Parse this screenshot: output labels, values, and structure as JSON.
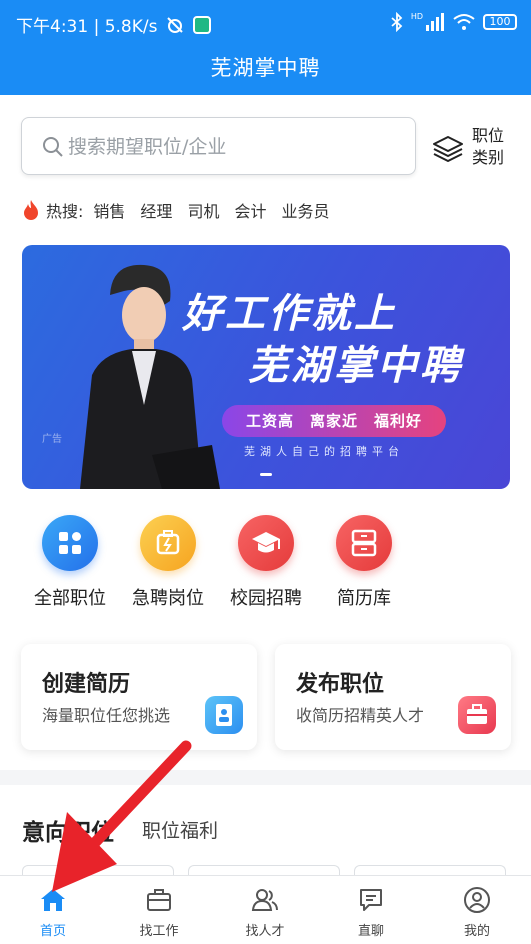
{
  "status_bar": {
    "time_speed": "下午4:31 | 5.8K/s",
    "hd_label": "HD",
    "battery": "100"
  },
  "header": {
    "title": "芜湖掌中聘"
  },
  "search": {
    "placeholder": "搜索期望职位/企业",
    "value": ""
  },
  "category_button": {
    "label": "职位类别"
  },
  "hot_search": {
    "label": "热搜:",
    "items": [
      "销售",
      "经理",
      "司机",
      "会计",
      "业务员"
    ]
  },
  "banner": {
    "line1": "好工作就上",
    "line2": "芜湖掌中聘",
    "pill": "工资高　离家近　福利好",
    "subtitle": "芜湖人自己的招聘平台",
    "ad_tag": "广告"
  },
  "quick_nav": [
    {
      "label": "全部职位",
      "icon": "grid-icon",
      "color": "#2f8df3"
    },
    {
      "label": "急聘岗位",
      "icon": "urgent-icon",
      "color": "#f7b52c"
    },
    {
      "label": "校园招聘",
      "icon": "graduation-cap-icon",
      "color": "#ef4b4b"
    },
    {
      "label": "简历库",
      "icon": "drawer-icon",
      "color": "#ef4b4b"
    }
  ],
  "cards": [
    {
      "title": "创建简历",
      "subtitle": "海量职位任您挑选",
      "icon": "resume-icon",
      "color": "#3aa8f0"
    },
    {
      "title": "发布职位",
      "subtitle": "收简历招精英人才",
      "icon": "briefcase-icon",
      "color": "#f0546a"
    }
  ],
  "section": {
    "active_tab": "意向职位",
    "tab": "职位福利"
  },
  "tabbar": {
    "items": [
      {
        "label": "首页",
        "icon": "home-icon",
        "active": true
      },
      {
        "label": "找工作",
        "icon": "briefcase-icon",
        "active": false
      },
      {
        "label": "找人才",
        "icon": "people-icon",
        "active": false
      },
      {
        "label": "直聊",
        "icon": "chat-icon",
        "active": false
      },
      {
        "label": "我的",
        "icon": "profile-icon",
        "active": false
      }
    ]
  },
  "colors": {
    "brand_blue": "#1a8cf5",
    "annotation_arrow": "#e8232a"
  }
}
